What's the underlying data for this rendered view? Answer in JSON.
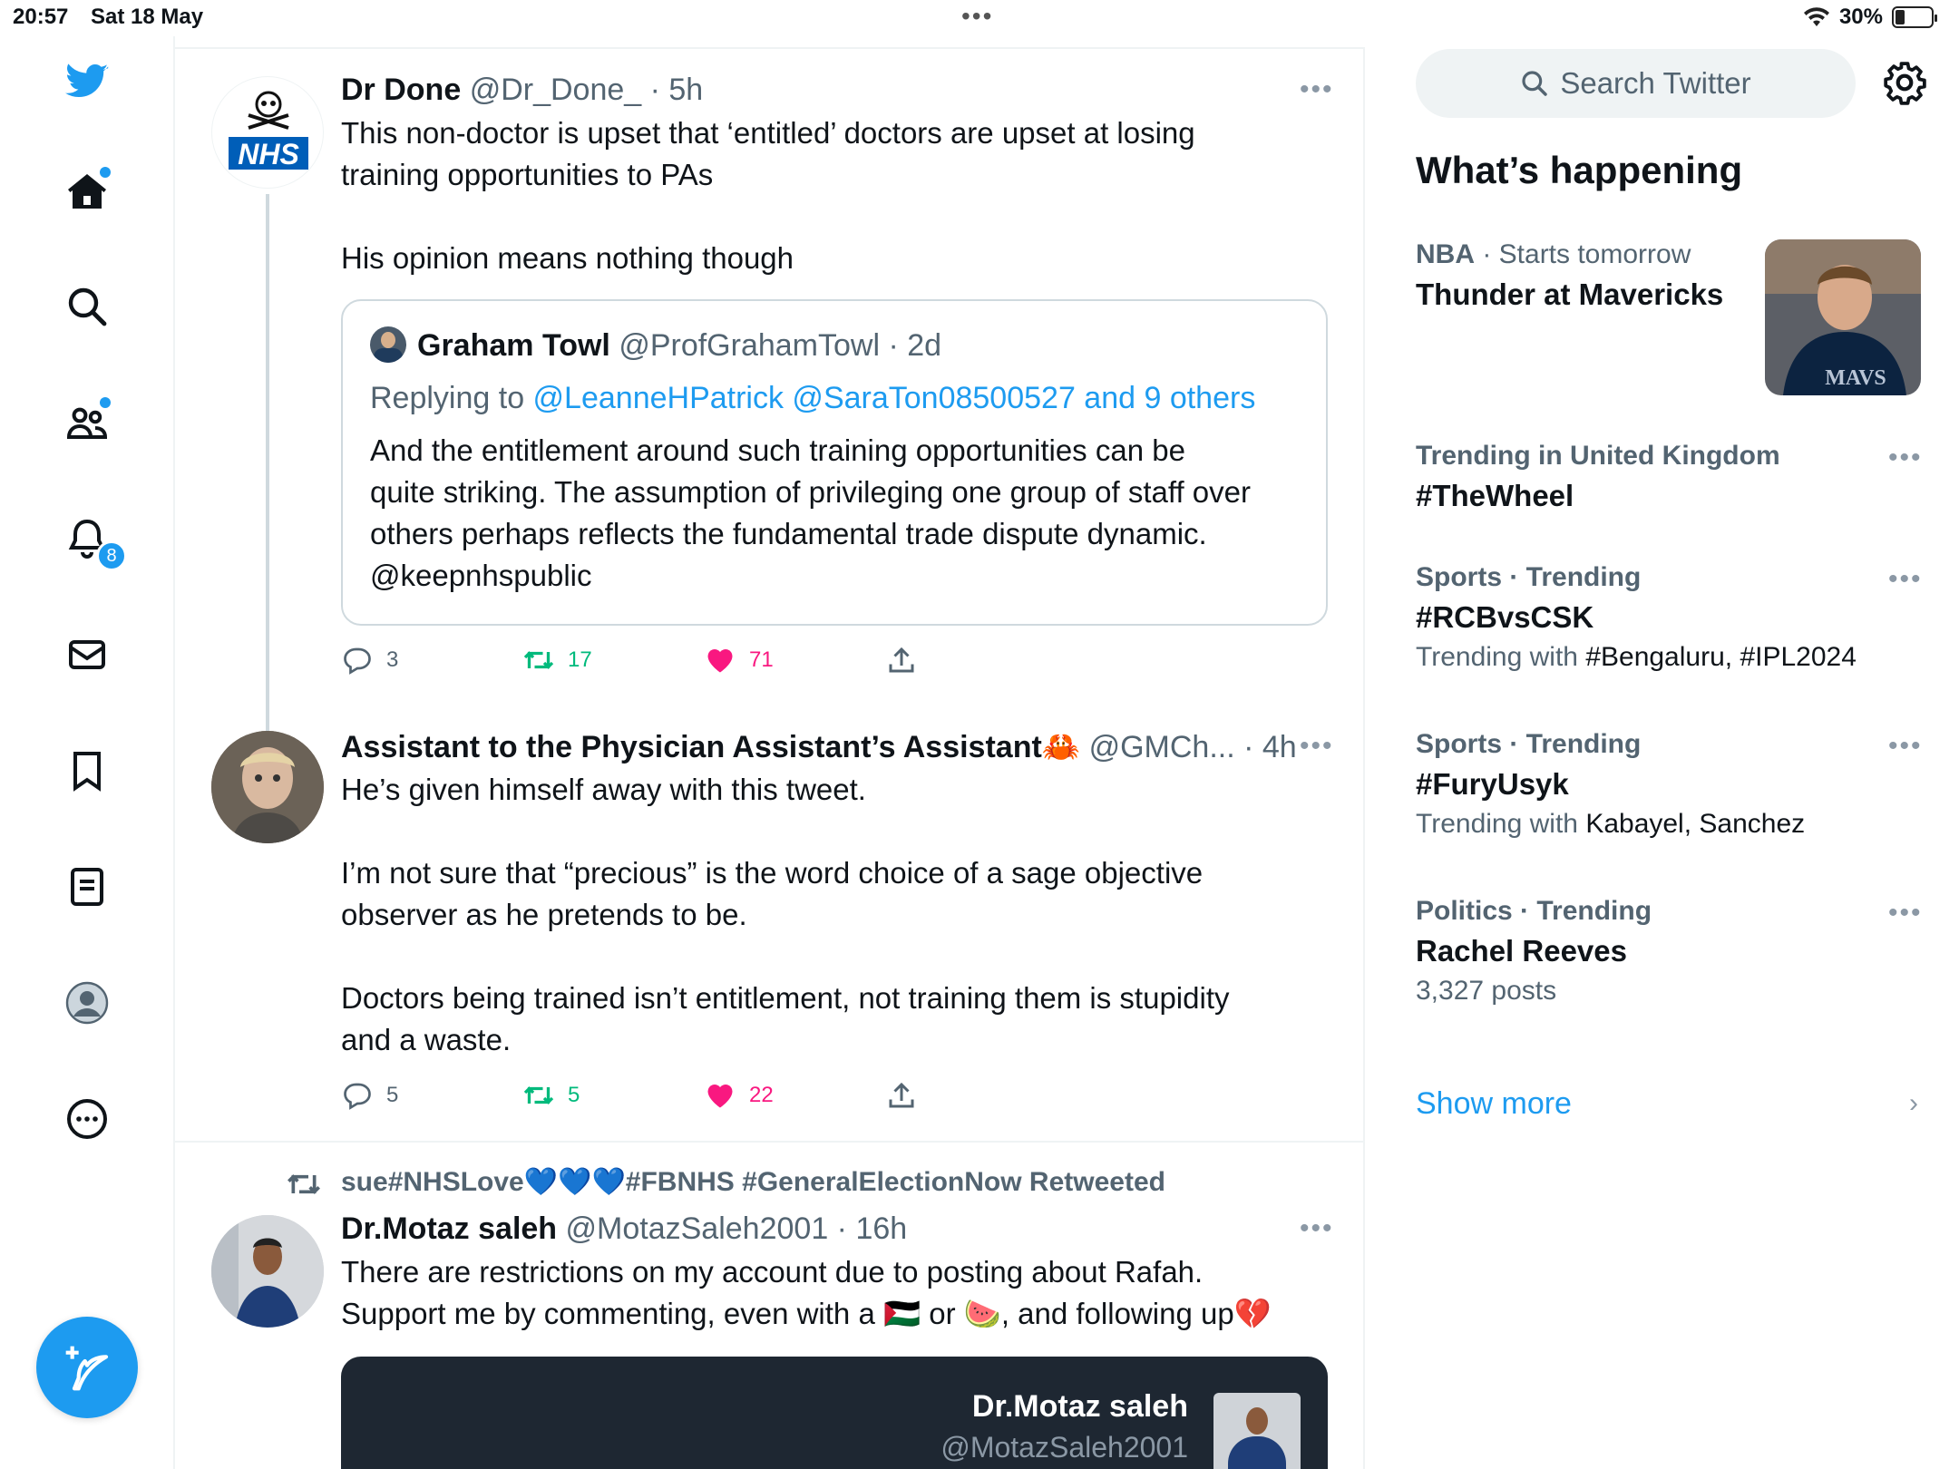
{
  "status_bar": {
    "time": "20:57",
    "date": "Sat 18 May",
    "battery": "30%"
  },
  "nav": {
    "notifications_badge": "8"
  },
  "tweets": [
    {
      "name": "Dr Done",
      "meta": "@Dr_Done_ · 5h",
      "text": [
        "This non-doctor is upset that ‘entitled’ doctors are upset at losing",
        "training opportunities to PAs",
        "",
        "His opinion means nothing though"
      ],
      "quote": {
        "name": "Graham Towl",
        "meta": "@ProfGrahamTowl · 2d",
        "replying_prefix": "Replying to ",
        "replying_to": "@LeanneHPatrick @SaraTon08500527 and 9 others",
        "text": [
          "And the entitlement around such training opportunities can be",
          "quite striking. The assumption of privileging one group of staff over",
          "others perhaps reflects the fundamental trade dispute dynamic.",
          "@keepnhspublic"
        ]
      },
      "replies": "3",
      "retweets": "17",
      "likes": "71"
    },
    {
      "name": "Assistant to the Physician Assistant’s Assistant🦀",
      "meta": "@GMCh... · 4h",
      "text": [
        "He’s given himself away with this tweet.",
        "",
        "I’m not sure that “precious” is the word choice of a sage objective",
        "observer as he pretends to be.",
        "",
        "Doctors being trained isn’t entitlement, not training them is stupidity",
        "and a waste."
      ],
      "replies": "5",
      "retweets": "5",
      "likes": "22"
    },
    {
      "retweeted_by": "sue#NHSLove💙💙💙#FBNHS #GeneralElectionNow Retweeted",
      "name": "Dr.Motaz saleh",
      "meta": "@MotazSaleh2001 · 16h",
      "text": [
        "There are restrictions on my account due to posting about Rafah.",
        "Support me by commenting, even with a 🇵🇸 or 🍉, and following up💔"
      ],
      "card": {
        "name": "Dr.Motaz saleh",
        "handle": "@MotazSaleh2001"
      }
    }
  ],
  "sidebar": {
    "search_placeholder": "Search Twitter",
    "heading": "What’s happening",
    "trends": [
      {
        "category": "NBA",
        "category_extra": " · Starts tomorrow",
        "title": "Thunder at Mavericks",
        "has_image": true
      },
      {
        "category": "Trending in United Kingdom",
        "title": "#TheWheel"
      },
      {
        "category": "Sports · Trending",
        "title": "#RCBvsCSK",
        "sub_prefix": "Trending with ",
        "sub_value": "#Bengaluru, #IPL2024"
      },
      {
        "category": "Sports · Trending",
        "title": "#FuryUsyk",
        "sub_prefix": "Trending with ",
        "sub_value": "Kabayel, Sanchez"
      },
      {
        "category": "Politics · Trending",
        "title": "Rachel Reeves",
        "sub_prefix": "3,327 posts",
        "sub_value": ""
      }
    ],
    "show_more": "Show more"
  },
  "colors": {
    "accent": "#1d9bf0",
    "retweet": "#00ba7c",
    "like": "#f91880",
    "muted": "#536471"
  }
}
